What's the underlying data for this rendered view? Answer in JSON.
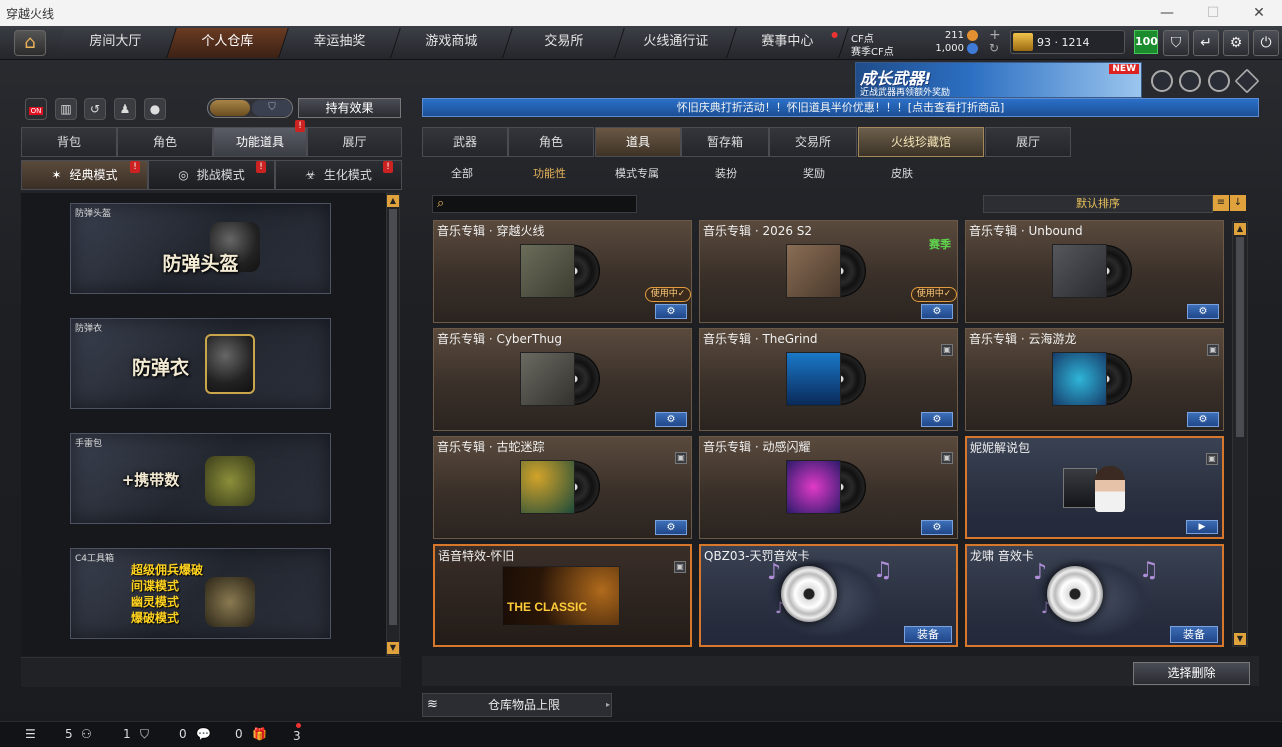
{
  "window": {
    "title": "穿越火线"
  },
  "nav": {
    "tabs": [
      {
        "label": "房间大厅"
      },
      {
        "label": "个人仓库"
      },
      {
        "label": "幸运抽奖"
      },
      {
        "label": "游戏商城"
      },
      {
        "label": "交易所"
      },
      {
        "label": "火线通行证"
      },
      {
        "label": "赛事中心"
      }
    ],
    "cf_label": "CF点",
    "cf_value": "211",
    "season_cf_label": "赛季CF点",
    "season_cf_value": "1,000",
    "level_text": "93 · 1214",
    "green_badge": "100"
  },
  "banner": {
    "title": "成长武器!",
    "subtitle": "近战武器再领额外奖励",
    "new_tag": "NEW"
  },
  "left": {
    "effects_button": "持有效果",
    "tabs": [
      {
        "label": "背包"
      },
      {
        "label": "角色"
      },
      {
        "label": "功能道具"
      },
      {
        "label": "展厅"
      }
    ],
    "modes": [
      {
        "label": "经典模式"
      },
      {
        "label": "挑战模式"
      },
      {
        "label": "生化模式"
      }
    ],
    "cards": [
      {
        "caption": "防弹头盔",
        "title": "防弹头盔"
      },
      {
        "caption": "防弹衣",
        "title": "防弹衣"
      },
      {
        "caption": "手雷包",
        "title": "+携带数"
      },
      {
        "caption": "C4工具箱",
        "lines": [
          "超级佣兵爆破",
          "间谍模式",
          "幽灵模式",
          "爆破模式"
        ]
      }
    ]
  },
  "right": {
    "notice": "怀旧庆典打折活动！！怀旧道具半价优惠！！！[点击查看打折商品]",
    "tabs": [
      {
        "label": "武器"
      },
      {
        "label": "角色"
      },
      {
        "label": "道具"
      },
      {
        "label": "暂存箱"
      },
      {
        "label": "交易所"
      },
      {
        "label": "火线珍藏馆"
      },
      {
        "label": "展厅"
      }
    ],
    "subtabs": [
      {
        "label": "全部"
      },
      {
        "label": "功能性"
      },
      {
        "label": "模式专属"
      },
      {
        "label": "装扮"
      },
      {
        "label": "奖励"
      },
      {
        "label": "皮肤"
      }
    ],
    "sort_label": "默认排序",
    "in_use": "使用中✓",
    "season_tag": "赛季",
    "equip": "装备",
    "classic_text": "THE CLASSIC",
    "items": [
      {
        "name": "音乐专辑 · 穿越火线"
      },
      {
        "name": "音乐专辑 · 2026 S2"
      },
      {
        "name": "音乐专辑 · Unbound"
      },
      {
        "name": "音乐专辑 · CyberThug"
      },
      {
        "name": "音乐专辑 · TheGrind"
      },
      {
        "name": "音乐专辑 · 云海游龙"
      },
      {
        "name": "音乐专辑 · 古蛇迷踪"
      },
      {
        "name": "音乐专辑 · 动感闪耀"
      },
      {
        "name": "妮妮解说包"
      },
      {
        "name": "语音特效-怀旧"
      },
      {
        "name": "QBZ03-天罚音效卡"
      },
      {
        "name": "龙啸 音效卡"
      }
    ],
    "delete_button": "选择删除",
    "capacity_label": "仓库物品上限"
  },
  "status": {
    "count1": "5",
    "count2": "1",
    "count3": "0",
    "count4": "0",
    "count5": "3"
  }
}
